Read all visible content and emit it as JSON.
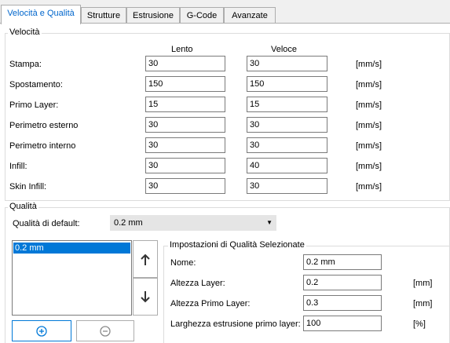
{
  "tabs": [
    "Velocità e Qualità",
    "Strutture",
    "Estrusione",
    "G-Code",
    "Avanzate"
  ],
  "speed": {
    "title": "Velocità",
    "col_slow": "Lento",
    "col_fast": "Veloce",
    "rows": [
      {
        "label": "Stampa:",
        "slow": "30",
        "fast": "30",
        "unit": "[mm/s]"
      },
      {
        "label": "Spostamento:",
        "slow": "150",
        "fast": "150",
        "unit": "[mm/s]"
      },
      {
        "label": "Primo Layer:",
        "slow": "15",
        "fast": "15",
        "unit": "[mm/s]"
      },
      {
        "label": "Perimetro esterno",
        "slow": "30",
        "fast": "30",
        "unit": "[mm/s]"
      },
      {
        "label": "Perimetro interno",
        "slow": "30",
        "fast": "30",
        "unit": "[mm/s]"
      },
      {
        "label": "Infill:",
        "slow": "30",
        "fast": "40",
        "unit": "[mm/s]"
      },
      {
        "label": "Skin Infill:",
        "slow": "30",
        "fast": "30",
        "unit": "[mm/s]"
      }
    ]
  },
  "quality": {
    "title": "Qualità",
    "default_label": "Qualità di default:",
    "default_value": "0.2 mm",
    "list_items": [
      "0.2 mm"
    ],
    "selected_title": "Impostazioni di Qualità Selezionate",
    "fields": [
      {
        "label": "Nome:",
        "value": "0.2 mm",
        "unit": ""
      },
      {
        "label": "Altezza Layer:",
        "value": "0.2",
        "unit": "[mm]"
      },
      {
        "label": "Altezza Primo Layer:",
        "value": "0.3",
        "unit": "[mm]"
      },
      {
        "label": "Larghezza estrusione primo layer:",
        "value": "100",
        "unit": "[%]"
      }
    ]
  }
}
